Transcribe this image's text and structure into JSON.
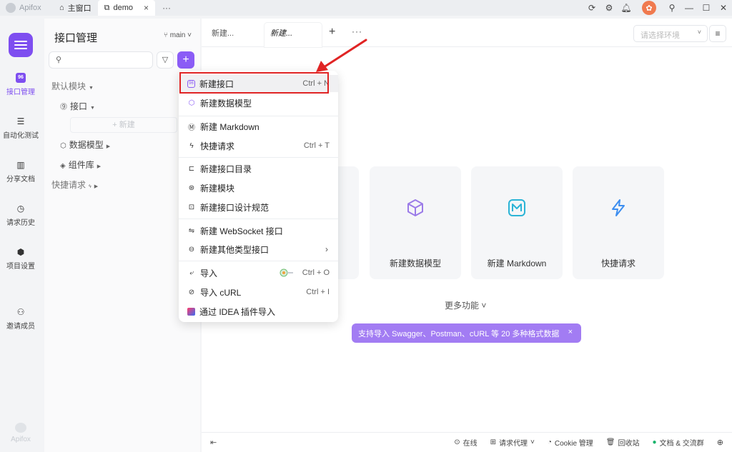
{
  "titlebar": {
    "brand": "Apifox",
    "tabs": [
      {
        "label": "主窗口",
        "icon": "home-icon"
      },
      {
        "label": "demo",
        "icon": "external-link-icon"
      }
    ],
    "close_glyph": "×",
    "more": "···"
  },
  "rail": {
    "items": [
      {
        "label": "接口管理",
        "icon": "api-icon",
        "glyph": "96"
      },
      {
        "label": "自动化测试",
        "icon": "automation-icon",
        "glyph": "☰"
      },
      {
        "label": "分享文档",
        "icon": "book-icon",
        "glyph": "▥"
      },
      {
        "label": "请求历史",
        "icon": "clock-icon",
        "glyph": "◷"
      },
      {
        "label": "项目设置",
        "icon": "settings-icon",
        "glyph": "⬢"
      },
      {
        "label": "邀请成员",
        "icon": "add-user-icon",
        "glyph": "⚇"
      }
    ],
    "footer_brand": "Apifox"
  },
  "panel": {
    "title": "接口管理",
    "branch": "main",
    "add_glyph": "+",
    "tree": {
      "default_module": "默认模块",
      "interfaces": "接口",
      "new": "+ 新建",
      "data_models": "数据模型",
      "components": "组件库",
      "quick_requests": "快捷请求"
    }
  },
  "main": {
    "tabs": [
      "新建...",
      "新建..."
    ],
    "plus": "+",
    "more": "···",
    "env_placeholder": "请选择环境",
    "cards": [
      {
        "label": "新建数据模型",
        "icon": "cube-icon"
      },
      {
        "label": "新建 Markdown",
        "icon": "markdown-icon"
      },
      {
        "label": "快捷请求",
        "icon": "lightning-icon"
      }
    ],
    "more_features": "更多功能 ˅",
    "banner": "支持导入 Swagger、Postman、cURL 等 20 多种格式数据",
    "banner_close": "×"
  },
  "statusbar": {
    "online": "在线",
    "proxy": "请求代理",
    "cookie": "Cookie 管理",
    "recycle": "回收站",
    "docs": "文档 & 交流群"
  },
  "menu": {
    "items": [
      {
        "label": "新建接口",
        "shortcut": "Ctrl + N",
        "icon": "api-badge-icon"
      },
      {
        "label": "新建数据模型",
        "icon": "cube-icon"
      },
      {
        "label": "新建 Markdown",
        "icon": "markdown-icon"
      },
      {
        "label": "快捷请求",
        "shortcut": "Ctrl + T",
        "icon": "lightning-icon"
      },
      {
        "label": "新建接口目录",
        "icon": "folder-plus-icon"
      },
      {
        "label": "新建模块",
        "icon": "module-icon"
      },
      {
        "label": "新建接口设计规范",
        "icon": "spec-icon"
      },
      {
        "label": "新建 WebSocket 接口",
        "icon": "websocket-icon"
      },
      {
        "label": "新建其他类型接口",
        "icon": "minus-circle-icon"
      },
      {
        "label": "导入",
        "shortcut": "Ctrl + O",
        "icon": "import-icon"
      },
      {
        "label": "导入 cURL",
        "shortcut": "Ctrl + I",
        "icon": "curl-icon"
      },
      {
        "label": "通过 IDEA 插件导入",
        "icon": "idea-icon"
      }
    ]
  },
  "colors": {
    "accent": "#8b5cf6",
    "annotation": "#e02424",
    "banner": "#a27cf3"
  }
}
